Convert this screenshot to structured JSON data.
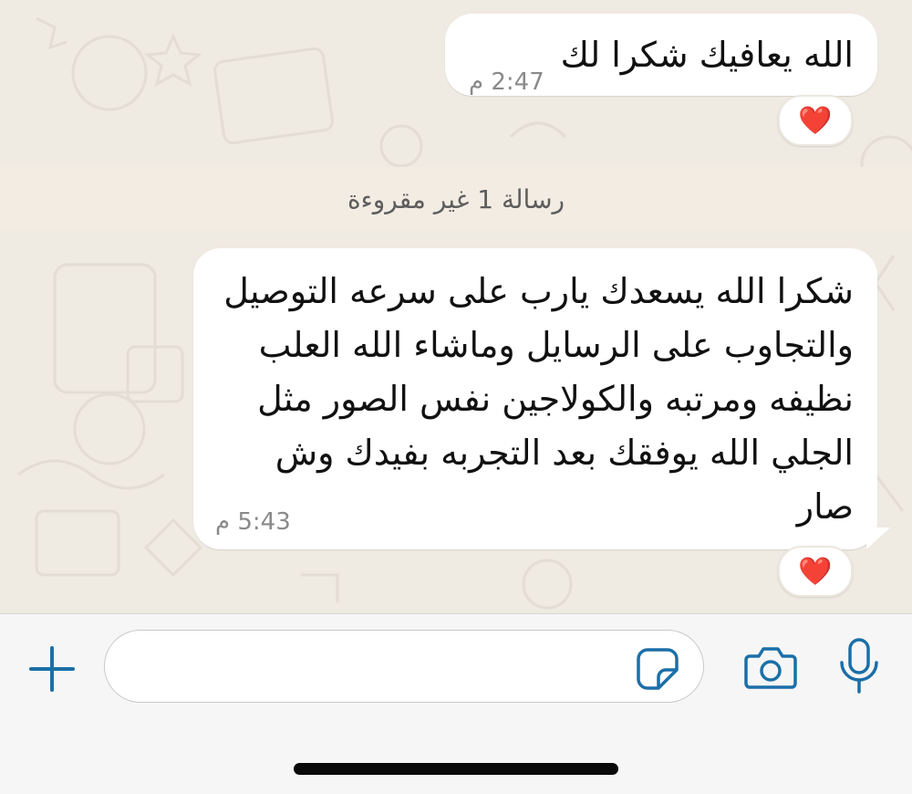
{
  "colors": {
    "chat_background": "#efeae2",
    "bubble": "#ffffff",
    "accent_icon": "#1b6fa8",
    "unread_banner": "#f3ece3",
    "reaction_heart": "#e0243a"
  },
  "messages": [
    {
      "text": "الله يعافيك شكرا لك",
      "time": "2:47 م",
      "reaction": "❤️"
    },
    {
      "text": "شكرا الله يسعدك يارب على سرعه التوصيل والتجاوب على الرسايل وماشاء الله العلب نظيفه ومرتبه والكولاجين نفس الصور مثل الجلي الله يوفقك بعد التجربه بفيدك وش صار",
      "time": "5:43 م",
      "reaction": "❤️"
    }
  ],
  "unread_banner": {
    "text": "رسالة 1 غير مقروءة"
  },
  "composer": {
    "input_value": "",
    "icons": {
      "plus": "plus-icon",
      "sticker": "sticker-icon",
      "camera": "camera-icon",
      "microphone": "microphone-icon"
    }
  }
}
